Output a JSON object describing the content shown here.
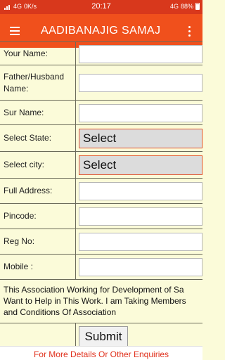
{
  "status": {
    "network": "4G",
    "speed": "0K/s",
    "time": "20:17",
    "net_right": "4G",
    "battery": "88%"
  },
  "appbar": {
    "title": "AADIBANAJIG SAMAJ",
    "menu_icon": "hamburger-icon",
    "more_icon": "more-vert-icon"
  },
  "form": {
    "your_name": {
      "label": "Your Name:",
      "value": ""
    },
    "father_husband_name": {
      "label": "Father/Husband Name:",
      "value": ""
    },
    "sur_name": {
      "label": "Sur Name:",
      "value": ""
    },
    "select_state": {
      "label": "Select State:",
      "selected": "Select"
    },
    "select_city": {
      "label": "Select city:",
      "selected": "Select"
    },
    "full_address": {
      "label": "Full Address:",
      "value": ""
    },
    "pincode": {
      "label": "Pincode:",
      "value": ""
    },
    "reg_no": {
      "label": "Reg No:",
      "value": ""
    },
    "mobile": {
      "label": "Mobile :",
      "value": ""
    },
    "about_lines": [
      "This Association Working for Development of Sa",
      "Want to Help in This Work. I am Taking Members",
      "and Conditions Of Association"
    ],
    "submit_label": "Submit"
  },
  "footer": {
    "text": "For More Details Or Other Enquiries"
  },
  "colors": {
    "statusbar": "#d8381c",
    "appbar": "#f0501c",
    "form_bg": "#fbfbd9",
    "footer_text": "#e0301c"
  }
}
